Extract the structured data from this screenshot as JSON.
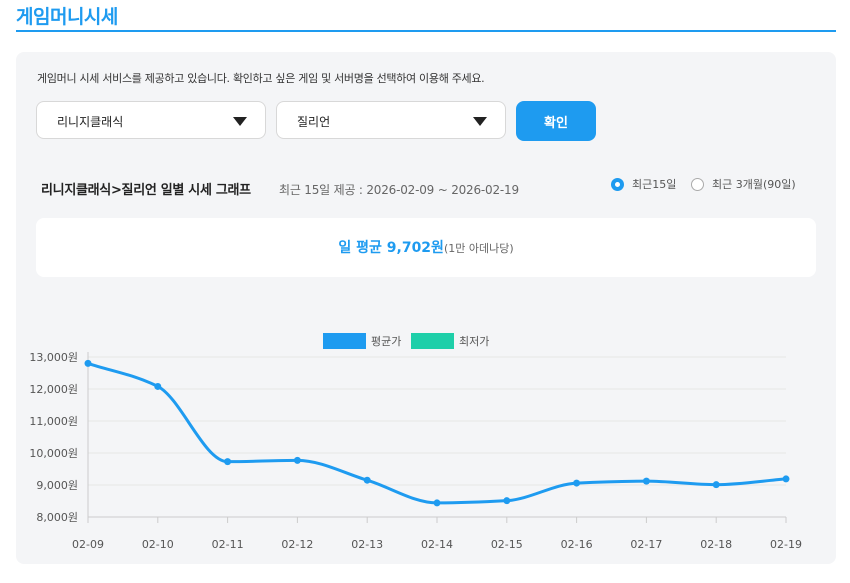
{
  "page": {
    "title": "게임머니시세"
  },
  "intro": "게임머니 시세 서비스를 제공하고 있습니다. 확인하고 싶은 게임 및 서버명을 선택하여 이용해 주세요.",
  "selects": {
    "game": "리니지클래식",
    "server": "질리언"
  },
  "confirm_label": "확인",
  "graph": {
    "title": "리니지클래식>질리언 일별 시세 그래프",
    "range": "최근 15일 제공 : 2026-02-09 ~ 2026-02-19"
  },
  "radios": [
    {
      "label": "최근15일",
      "checked": true
    },
    {
      "label": "최근 3개월(90일)",
      "checked": false
    }
  ],
  "average": {
    "main": "일 평균 9,702원",
    "unit": "(1만 아데나당)"
  },
  "colors": {
    "accent": "#1e9bf0",
    "low": "#1ecfa9"
  },
  "chart_data": {
    "type": "line",
    "categories": [
      "02-09",
      "02-10",
      "02-11",
      "02-12",
      "02-13",
      "02-14",
      "02-15",
      "02-16",
      "02-17",
      "02-18",
      "02-19"
    ],
    "series": [
      {
        "name": "평균가",
        "color": "#1e9bf0",
        "values": [
          12800,
          12080,
          9730,
          9770,
          9150,
          8440,
          8510,
          9060,
          9120,
          9010,
          9190
        ]
      },
      {
        "name": "최저가",
        "color": "#1ecfa9",
        "values": []
      }
    ],
    "ylim": [
      8000,
      13000
    ],
    "yticks": [
      {
        "value": 13000,
        "label": "13,000원"
      },
      {
        "value": 12000,
        "label": "12,000원"
      },
      {
        "value": 11000,
        "label": "11,000원"
      },
      {
        "value": 10000,
        "label": "10,000원"
      },
      {
        "value": 9000,
        "label": "9,000원"
      },
      {
        "value": 8000,
        "label": "8,000원"
      }
    ],
    "grid": true,
    "legend": "top-center"
  }
}
